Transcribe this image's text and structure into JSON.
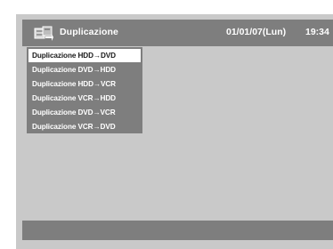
{
  "header": {
    "title": "Duplicazione",
    "date": "01/01/07(Lun)",
    "time": "19:34",
    "icon": "duplicate-icon"
  },
  "menu": {
    "items": [
      {
        "label": "Duplicazione HDD→DVD",
        "selected": true
      },
      {
        "label": "Duplicazione DVD→HDD",
        "selected": false
      },
      {
        "label": "Duplicazione HDD→VCR",
        "selected": false
      },
      {
        "label": "Duplicazione VCR→HDD",
        "selected": false
      },
      {
        "label": "Duplicazione DVD→VCR",
        "selected": false
      },
      {
        "label": "Duplicazione VCR→DVD",
        "selected": false
      }
    ]
  },
  "colors": {
    "screen_bg": "#c9c9c9",
    "bar_bg": "#7e7e7e",
    "selected_bg": "#ffffff"
  }
}
